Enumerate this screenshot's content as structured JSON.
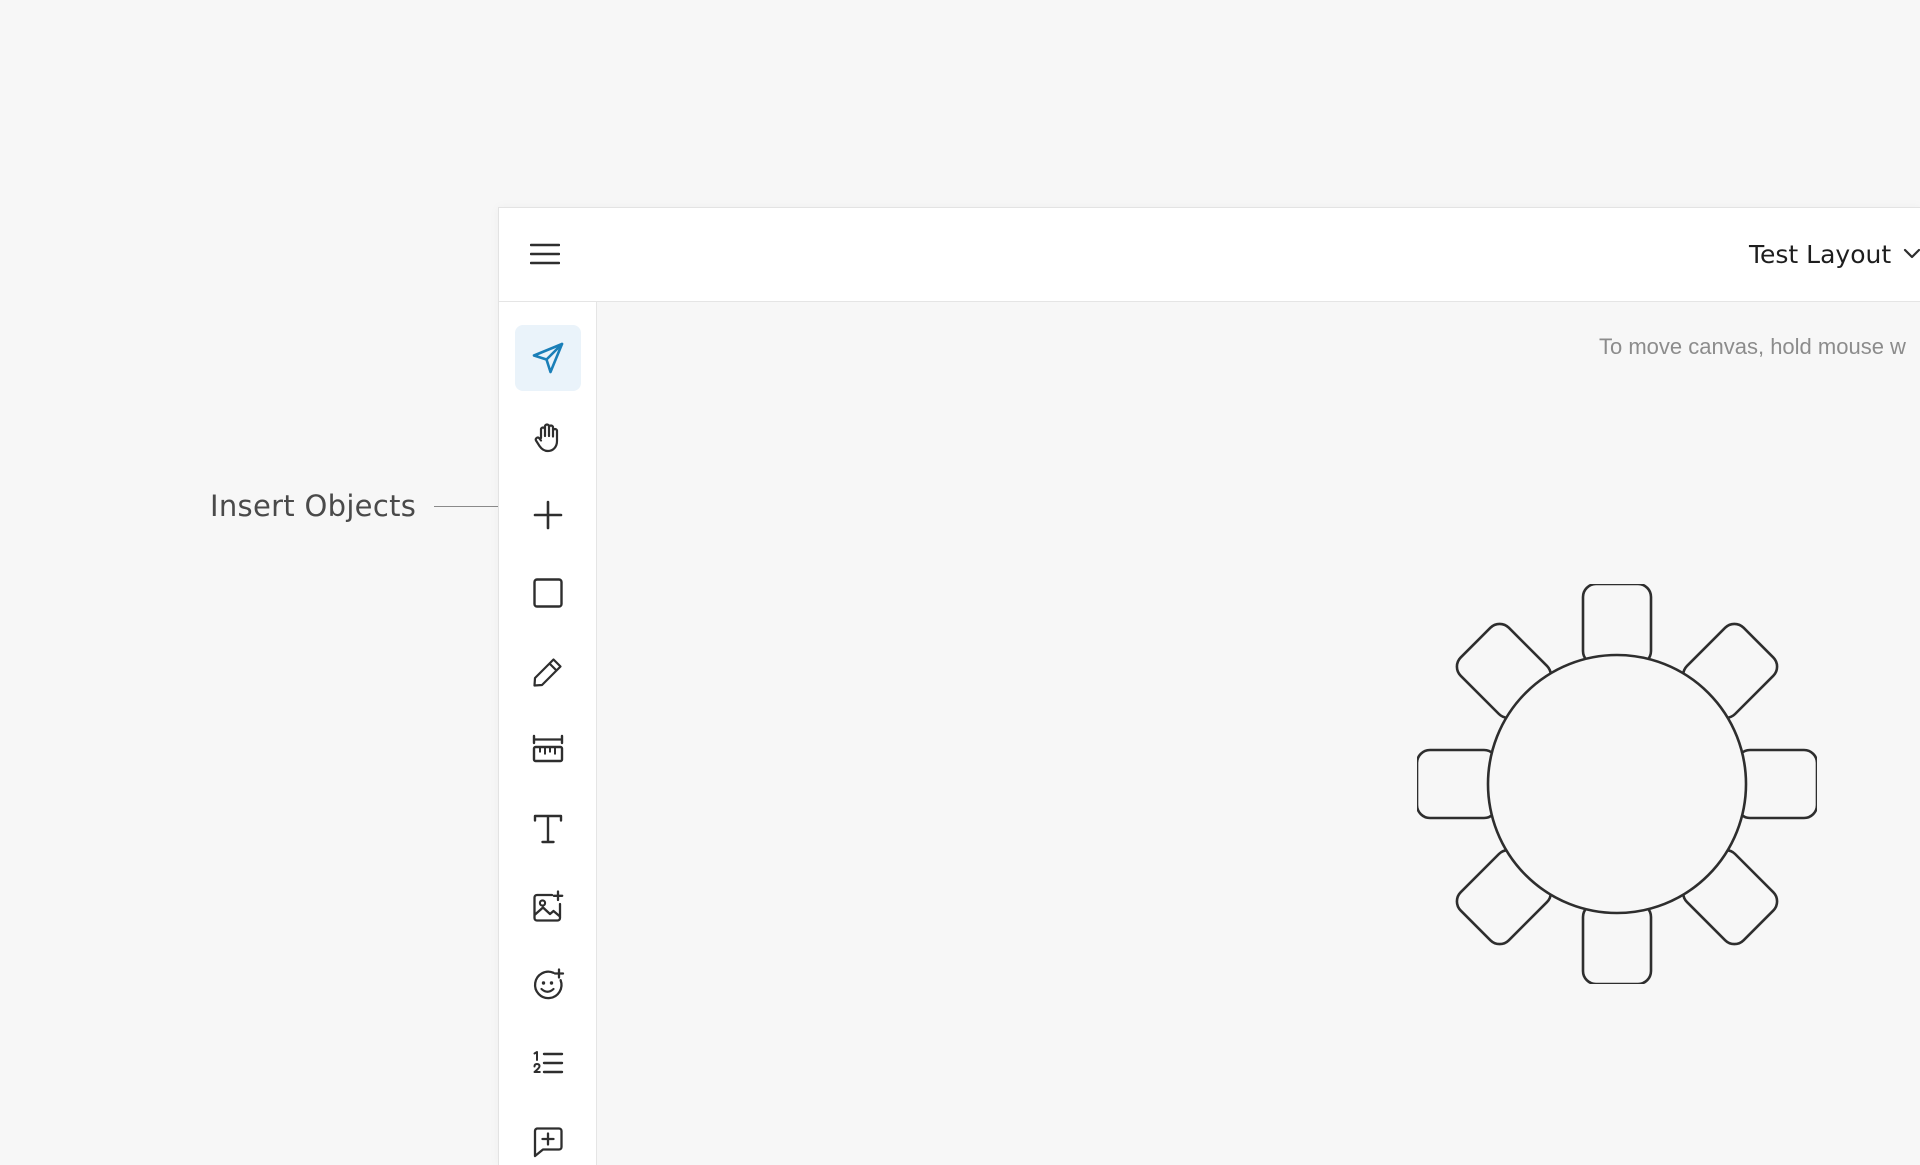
{
  "callout": {
    "label": "Insert Objects"
  },
  "header": {
    "menu_icon": "hamburger-menu-icon",
    "layout_name": "Test Layout",
    "layout_dropdown_icon": "chevron-down-icon"
  },
  "toolbar": {
    "active_tool": "select",
    "tools": [
      {
        "id": "select",
        "icon": "navigation-arrow-icon"
      },
      {
        "id": "pan",
        "icon": "hand-icon"
      },
      {
        "id": "insert-objects",
        "icon": "plus-icon"
      },
      {
        "id": "shape",
        "icon": "square-icon"
      },
      {
        "id": "draw",
        "icon": "pencil-icon"
      },
      {
        "id": "measure",
        "icon": "ruler-icon"
      },
      {
        "id": "text",
        "icon": "text-icon"
      },
      {
        "id": "image",
        "icon": "image-add-icon"
      },
      {
        "id": "sticker",
        "icon": "emoji-add-icon"
      },
      {
        "id": "numbered-list",
        "icon": "numbered-list-icon"
      },
      {
        "id": "comment",
        "icon": "comment-add-icon"
      }
    ]
  },
  "canvas": {
    "hint": "To move canvas, hold mouse w",
    "objects": [
      {
        "type": "round-table",
        "seats": 8
      }
    ]
  },
  "colors": {
    "accent": "#1a7fb8",
    "active_tool_bg": "#eaf3fa",
    "icon": "#2e2e2e",
    "canvas_bg": "#f7f7f7"
  }
}
